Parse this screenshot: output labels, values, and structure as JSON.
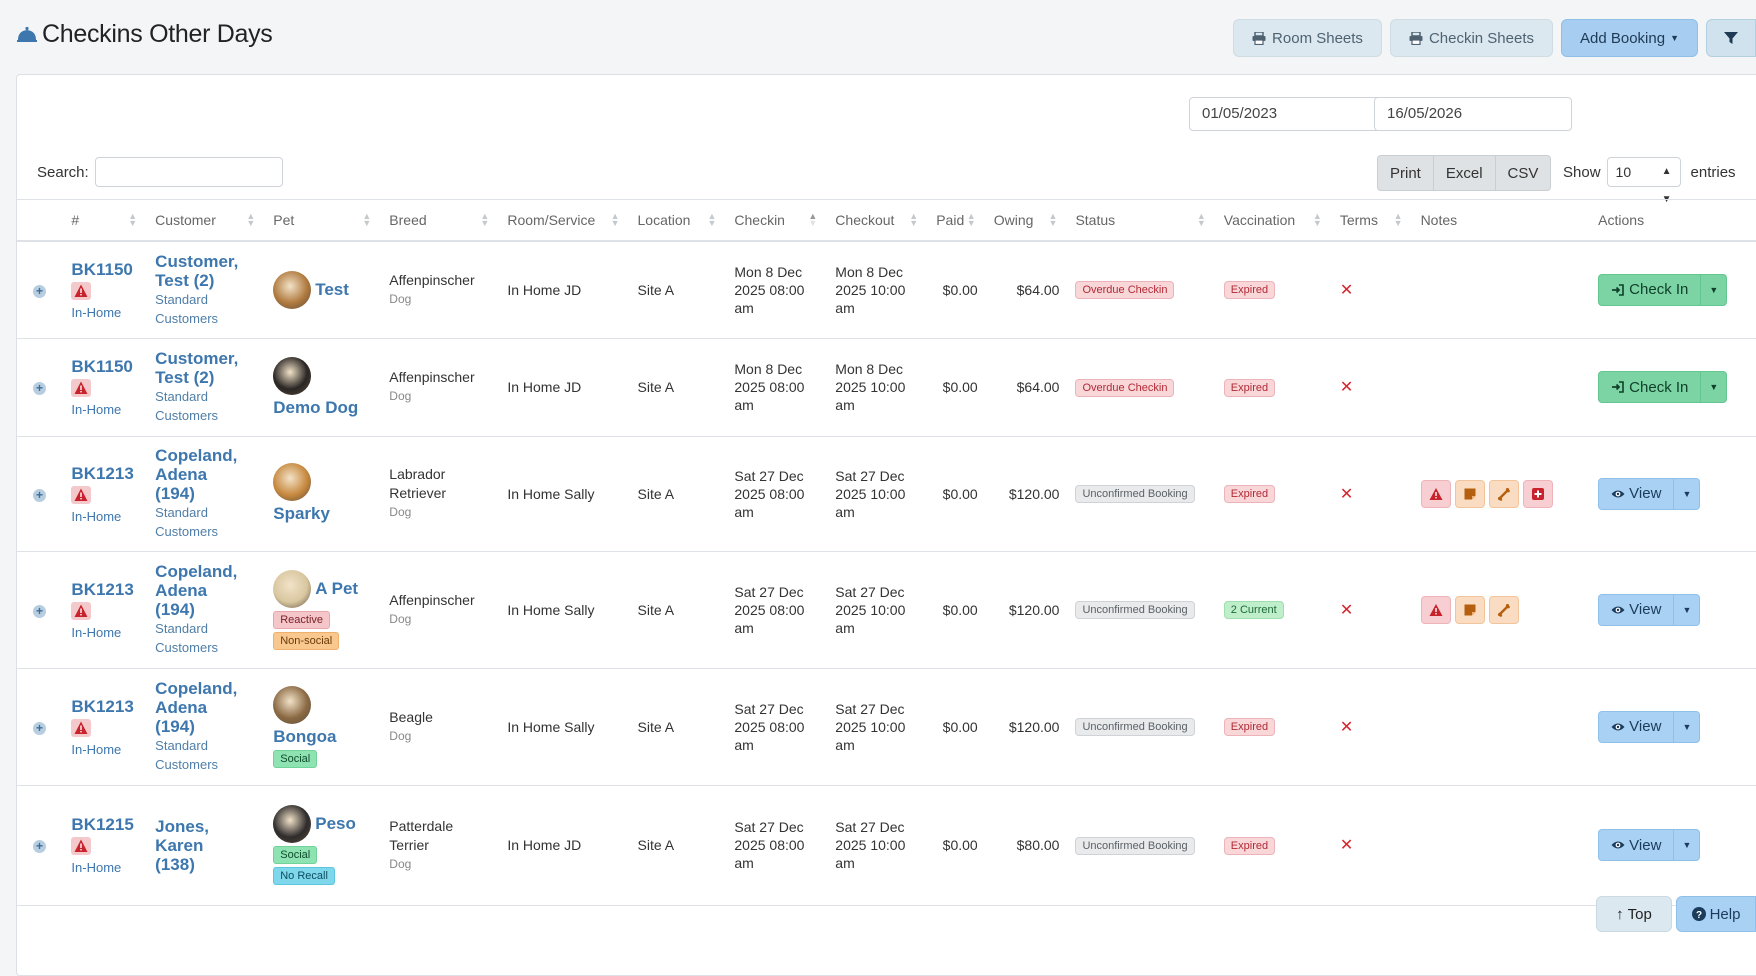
{
  "page": {
    "title": "Checkins Other Days"
  },
  "toolbar": {
    "room_sheets": "Room Sheets",
    "checkin_sheets": "Checkin Sheets",
    "add_booking": "Add Booking"
  },
  "filters": {
    "date_from": "01/05/2023",
    "date_to": "16/05/2026"
  },
  "search": {
    "label": "Search:",
    "value": ""
  },
  "export": {
    "print": "Print",
    "excel": "Excel",
    "csv": "CSV"
  },
  "length": {
    "show_label": "Show",
    "value": "10",
    "entries_label": "entries"
  },
  "columns": [
    "#",
    "Customer",
    "Pet",
    "Breed",
    "Room/Service",
    "Location",
    "Checkin",
    "Checkout",
    "Paid",
    "Owing",
    "Status",
    "Vaccination",
    "Terms",
    "Notes",
    "Actions"
  ],
  "rows": [
    {
      "booking": "BK1150",
      "booking_type": "In-Home",
      "customer": [
        "Customer,",
        "Test (2)"
      ],
      "customer_type": [
        "Standard",
        "Customers"
      ],
      "pet": "Test",
      "pet_name_inline": true,
      "tags": [],
      "breed": "Affenpinscher",
      "species": "Dog",
      "room": "In Home JD",
      "location": "Site A",
      "checkin": [
        "Mon 8 Dec",
        "2025 08:00",
        "am"
      ],
      "checkout": [
        "Mon 8 Dec",
        "2025 10:00",
        "am"
      ],
      "paid": "$0.00",
      "owing": "$64.00",
      "status": "Overdue Checkin",
      "status_kind": "overdue",
      "vaccination": "Expired",
      "vacc_kind": "expired",
      "terms": "✕",
      "notes": [],
      "action": "Check In",
      "action_kind": "green"
    },
    {
      "booking": "BK1150",
      "booking_type": "In-Home",
      "customer": [
        "Customer,",
        "Test (2)"
      ],
      "customer_type": [
        "Standard",
        "Customers"
      ],
      "pet": "Demo Dog",
      "pet_name_inline": false,
      "tags": [],
      "breed": "Affenpinscher",
      "species": "Dog",
      "room": "In Home JD",
      "location": "Site A",
      "checkin": [
        "Mon 8 Dec",
        "2025 08:00",
        "am"
      ],
      "checkout": [
        "Mon 8 Dec",
        "2025 10:00",
        "am"
      ],
      "paid": "$0.00",
      "owing": "$64.00",
      "status": "Overdue Checkin",
      "status_kind": "overdue",
      "vaccination": "Expired",
      "vacc_kind": "expired",
      "terms": "✕",
      "notes": [],
      "action": "Check In",
      "action_kind": "green"
    },
    {
      "booking": "BK1213",
      "booking_type": "In-Home",
      "customer": [
        "Copeland,",
        "Adena",
        "(194)"
      ],
      "customer_type": [
        "Standard",
        "Customers"
      ],
      "pet": "Sparky",
      "pet_name_inline": false,
      "tags": [],
      "breed": "Labrador Retriever",
      "species": "Dog",
      "room": "In Home Sally",
      "location": "Site A",
      "checkin": [
        "Sat 27 Dec",
        "2025 08:00",
        "am"
      ],
      "checkout": [
        "Sat 27 Dec",
        "2025 10:00",
        "am"
      ],
      "paid": "$0.00",
      "owing": "$120.00",
      "status": "Unconfirmed Booking",
      "status_kind": "unconf",
      "vaccination": "Expired",
      "vacc_kind": "expired",
      "terms": "✕",
      "notes": [
        "alert",
        "note",
        "bone",
        "medical"
      ],
      "action": "View",
      "action_kind": "blue"
    },
    {
      "booking": "BK1213",
      "booking_type": "In-Home",
      "customer": [
        "Copeland,",
        "Adena",
        "(194)"
      ],
      "customer_type": [
        "Standard",
        "Customers"
      ],
      "pet": "A Pet",
      "pet_name_inline": true,
      "tags": [
        {
          "label": "Reactive",
          "kind": "reactive"
        },
        {
          "label": "Non-social",
          "kind": "nonsocial"
        }
      ],
      "breed": "Affenpinscher",
      "species": "Dog",
      "room": "In Home Sally",
      "location": "Site A",
      "checkin": [
        "Sat 27 Dec",
        "2025 08:00",
        "am"
      ],
      "checkout": [
        "Sat 27 Dec",
        "2025 10:00",
        "am"
      ],
      "paid": "$0.00",
      "owing": "$120.00",
      "status": "Unconfirmed Booking",
      "status_kind": "unconf",
      "vaccination": "2 Current",
      "vacc_kind": "current",
      "terms": "✕",
      "notes": [
        "alert",
        "note",
        "bone"
      ],
      "action": "View",
      "action_kind": "blue"
    },
    {
      "booking": "BK1213",
      "booking_type": "In-Home",
      "customer": [
        "Copeland,",
        "Adena",
        "(194)"
      ],
      "customer_type": [
        "Standard",
        "Customers"
      ],
      "pet": "Bongoa",
      "pet_name_inline": false,
      "tags": [
        {
          "label": "Social",
          "kind": "social"
        }
      ],
      "breed": "Beagle",
      "species": "Dog",
      "room": "In Home Sally",
      "location": "Site A",
      "checkin": [
        "Sat 27 Dec",
        "2025 08:00",
        "am"
      ],
      "checkout": [
        "Sat 27 Dec",
        "2025 10:00",
        "am"
      ],
      "paid": "$0.00",
      "owing": "$120.00",
      "status": "Unconfirmed Booking",
      "status_kind": "unconf",
      "vaccination": "Expired",
      "vacc_kind": "expired",
      "terms": "✕",
      "notes": [],
      "action": "View",
      "action_kind": "blue"
    },
    {
      "booking": "BK1215",
      "booking_type": "In-Home",
      "customer": [
        "Jones,",
        "Karen",
        "(138)"
      ],
      "customer_type": [],
      "pet": "Peso",
      "pet_name_inline": true,
      "tags": [
        {
          "label": "Social",
          "kind": "social"
        },
        {
          "label": "No Recall",
          "kind": "norecall"
        }
      ],
      "breed": "Patterdale Terrier",
      "species": "Dog",
      "room": "In Home JD",
      "location": "Site A",
      "checkin": [
        "Sat 27 Dec",
        "2025 08:00",
        "am"
      ],
      "checkout": [
        "Sat 27 Dec",
        "2025 10:00",
        "am"
      ],
      "paid": "$0.00",
      "owing": "$80.00",
      "status": "Unconfirmed Booking",
      "status_kind": "unconf",
      "vaccination": "Expired",
      "vacc_kind": "expired",
      "terms": "✕",
      "notes": [],
      "action": "View",
      "action_kind": "blue"
    }
  ],
  "float": {
    "top": "Top",
    "help": "Help"
  },
  "colors": {
    "link": "#3d77ad",
    "primary_btn": "#a7cdf0",
    "success_btn": "#7cd3a4",
    "danger": "#d6262d"
  },
  "icons": {
    "title": "bell-icon",
    "print": "printer-icon",
    "filter": "funnel-icon",
    "top": "arrow-up-icon",
    "help": "question-circle-icon"
  }
}
